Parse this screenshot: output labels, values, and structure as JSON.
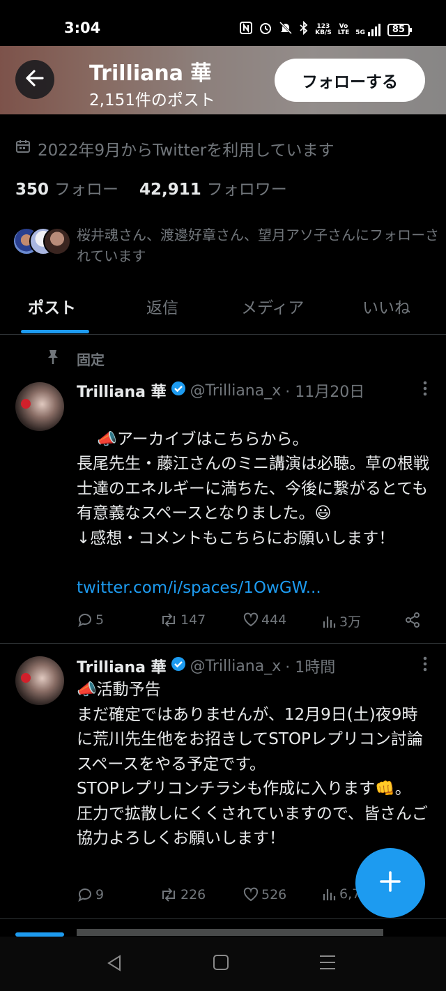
{
  "status_bar": {
    "time": "3:04",
    "net_speed_top": "123",
    "net_speed_bottom": "KB/S",
    "volte_top": "Vo",
    "volte_bottom": "LTE",
    "network": "5G",
    "battery": "85"
  },
  "header": {
    "name": "Trilliana 華",
    "post_count": "2,151件のポスト",
    "follow_label": "フォローする"
  },
  "profile": {
    "joined": "2022年9月からTwitterを利用しています",
    "following_count": "350",
    "following_label": "フォロー",
    "followers_count": "42,911",
    "followers_label": "フォロワー",
    "followed_by": "桜井魂さん、渡邊好章さん、望月アソ子さんにフォローされています"
  },
  "tabs": [
    {
      "label": "ポスト",
      "active": true
    },
    {
      "label": "返信",
      "active": false
    },
    {
      "label": "メディア",
      "active": false
    },
    {
      "label": "いいね",
      "active": false
    }
  ],
  "pinned_label": "固定",
  "posts": [
    {
      "name": "Trilliana 華",
      "handle": "@Trilliana_x",
      "time": "· 11月20日",
      "body": "📣アーカイブはこちらから。\n長尾先生・藤江さんのミニ講演は必聴。草の根戦士達のエネルギーに満ちた、今後に繋がるとても有意義なスペースとなりました。😃\n↓感想・コメントもこちらにお願いします！",
      "link": "twitter.com/i/spaces/1OwGW...",
      "replies": "5",
      "reposts": "147",
      "likes": "444",
      "views": "3万"
    },
    {
      "name": "Trilliana 華",
      "handle": "@Trilliana_x",
      "time": "· 1時間",
      "body": "📣活動予告\nまだ確定ではありませんが、12月9日(土)夜9時に荒川先生他をお招きしてSTOPレプリコン討論スペースをやる予定です。\nSTOPレプリコンチラシも作成に入ります👊。\n圧力で拡散しにくくされていますので、皆さんご協力よろしくお願いします！",
      "replies": "9",
      "reposts": "226",
      "likes": "526",
      "views": "6,7"
    }
  ],
  "icons": {
    "back": "arrow-left-icon",
    "calendar": "calendar-icon",
    "pin": "pin-icon",
    "verified": "verified-badge-icon",
    "reply": "reply-icon",
    "repost": "repost-icon",
    "like": "heart-icon",
    "views": "views-icon",
    "share": "share-icon",
    "compose": "plus-icon"
  },
  "colors": {
    "accent": "#1d9bf0",
    "background": "#000000",
    "text_primary": "#e7e9ea",
    "text_secondary": "#71767b"
  }
}
